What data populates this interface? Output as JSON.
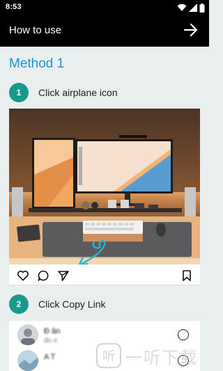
{
  "status_bar": {
    "time": "8:53"
  },
  "app_bar": {
    "title": "How to use"
  },
  "method": {
    "title": "Method 1"
  },
  "steps": [
    {
      "number": "1",
      "label": "Click airplane icon"
    },
    {
      "number": "2",
      "label": "Click Copy Link"
    }
  ],
  "share_sheet": {
    "contacts": [
      {
        "name": "Đ      ân",
        "username": "do      e"
      },
      {
        "name": "A      T      "
      }
    ]
  },
  "watermark": {
    "text": "一听下载"
  },
  "colors": {
    "accent_blue": "#1f8fd9",
    "step_teal": "#17998b",
    "app_bar": "#000000",
    "page_bg": "#e9eeee"
  },
  "icons": [
    "wifi-icon",
    "signal-icon",
    "battery-icon",
    "arrow-right-icon",
    "heart-icon",
    "comment-icon",
    "send-icon",
    "bookmark-icon"
  ]
}
